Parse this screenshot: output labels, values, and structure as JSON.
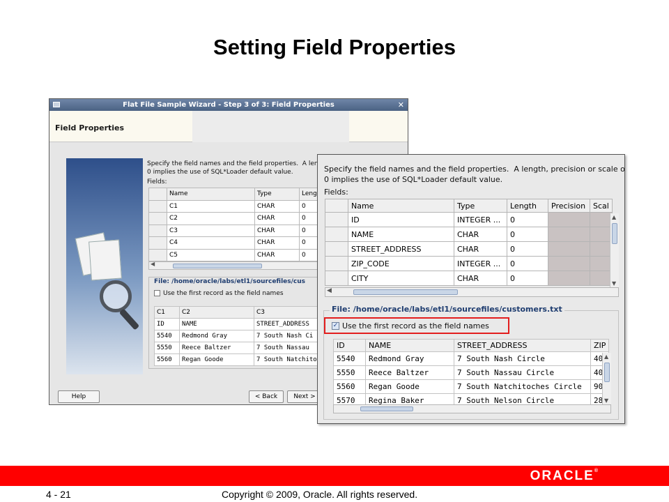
{
  "slide": {
    "title": "Setting Field Properties",
    "page_number": "4 - 21",
    "copyright": "Copyright © 2009, Oracle. All rights reserved.",
    "logo": "ORACLE",
    "brand_color": "#ff0000"
  },
  "back_window": {
    "title": "Flat File Sample Wizard - Step 3 of 3: Field Properties",
    "header": "Field Properties",
    "description_line1": "Specify the field names and the field properties.  A leng",
    "description_line2": "0 implies the use of SQL*Loader default value.",
    "fields_label": "Fields:",
    "columns": [
      "Name",
      "Type",
      "Leng"
    ],
    "rows": [
      [
        "C1",
        "CHAR",
        "0"
      ],
      [
        "C2",
        "CHAR",
        "0"
      ],
      [
        "C3",
        "CHAR",
        "0"
      ],
      [
        "C4",
        "CHAR",
        "0"
      ],
      [
        "C5",
        "CHAR",
        "0"
      ]
    ],
    "file_label": "File: /home/oracle/labs/etl1/sourcefiles/cus",
    "checkbox_label": "Use the first record as the field names",
    "sample_columns": [
      "C1",
      "C2",
      "C3"
    ],
    "sample_rows": [
      [
        "ID",
        "NAME",
        "STREET_ADDRESS"
      ],
      [
        "5540",
        "Redmond Gray",
        "7 South Nash Ci"
      ],
      [
        "5550",
        "Reece Baltzer",
        "7 South Nassau"
      ],
      [
        "5560",
        "Regan Goode",
        "7 South Natchito"
      ]
    ],
    "buttons": {
      "help": "Help",
      "back": "< Back",
      "next": "Next >"
    }
  },
  "front_window": {
    "description_line1": "Specify the field names and the field properties.  A length, precision or scale of",
    "description_line2": "0 implies the use of SQL*Loader default value.",
    "fields_label": "Fields:",
    "columns": [
      "Name",
      "Type",
      "Length",
      "Precision",
      "Scal"
    ],
    "rows": [
      [
        "ID",
        "INTEGER ...",
        "0"
      ],
      [
        "NAME",
        "CHAR",
        "0"
      ],
      [
        "STREET_ADDRESS",
        "CHAR",
        "0"
      ],
      [
        "ZIP_CODE",
        "INTEGER ...",
        "0"
      ],
      [
        "CITY",
        "CHAR",
        "0"
      ]
    ],
    "file_label": "File: /home/oracle/labs/etl1/sourcefiles/customers.txt",
    "checkbox_label": "Use the first record as the field names",
    "checkbox_checked": true,
    "sample_columns": [
      "ID",
      "NAME",
      "STREET_ADDRESS",
      "ZIP"
    ],
    "sample_rows": [
      [
        "5540",
        "Redmond Gray",
        "7 South Nash Circle",
        "40"
      ],
      [
        "5550",
        "Reece Baltzer",
        "7 South Nassau Circle",
        "40"
      ],
      [
        "5560",
        "Regan Goode",
        "7 South Natchitoches Circle",
        "90"
      ],
      [
        "5570",
        "Regina Baker",
        "7 South Nelson Circle",
        "28"
      ]
    ]
  }
}
